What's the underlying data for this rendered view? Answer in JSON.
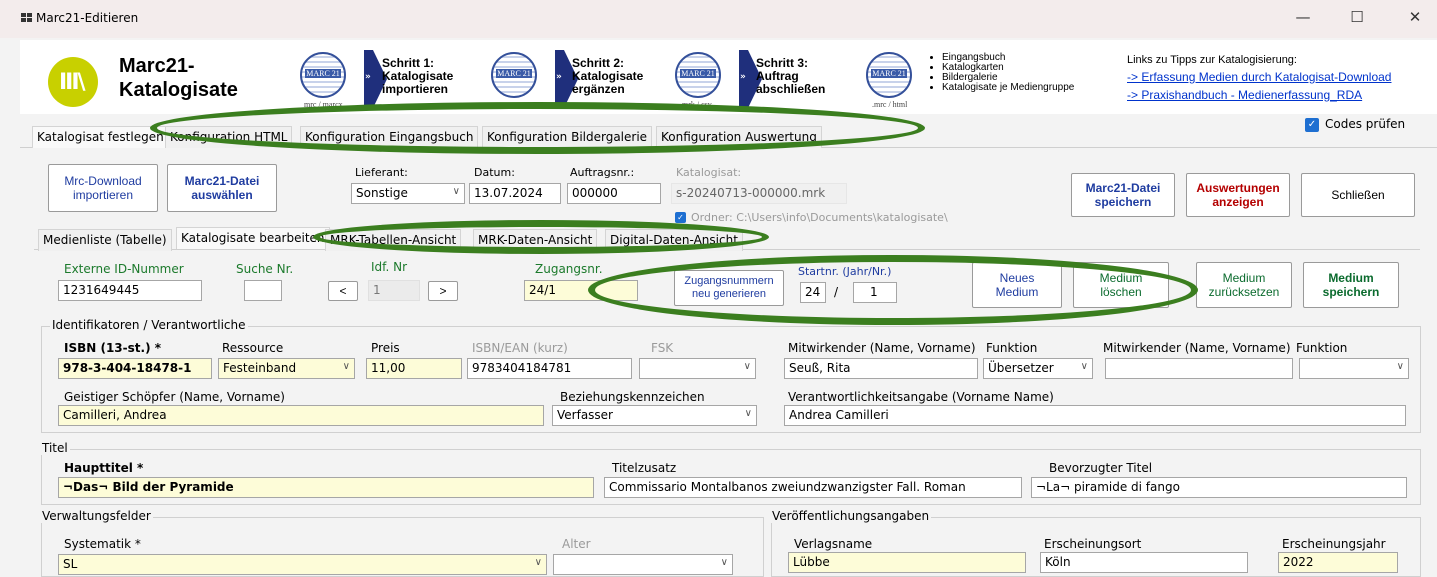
{
  "window": {
    "title": "Marc21-Editieren",
    "minimize": "—",
    "maximize": "☐",
    "close": "✕"
  },
  "banner": {
    "app_title_line1": "Marc21-",
    "app_title_line2": "Katalogisate",
    "logo_text": "III\\",
    "marc_label": "MARC 21",
    "captions": [
      "mrc / marcx",
      "mrk / csv",
      ".mrc / html"
    ],
    "steps": [
      {
        "line1": "Schritt 1:",
        "line2": "Katalogisate",
        "line3": "importieren"
      },
      {
        "line1": "Schritt 2:",
        "line2": "Katalogisate",
        "line3": "ergänzen"
      },
      {
        "line1": "Schritt 3:",
        "line2": "Auftrag",
        "line3": "abschließen"
      }
    ],
    "bullets": [
      "Eingangsbuch",
      "Katalogkarten",
      "Bildergalerie",
      "Katalogisate je Mediengruppe"
    ],
    "links_title": "Links zu Tipps zur Katalogisierung:",
    "link1": "-> Erfassung Medien durch Katalogisat-Download",
    "link2": "-> Praxishandbuch - Medienerfassung_RDA"
  },
  "main_tabs": [
    "Katalogisat festlegen",
    "Konfiguration HTML",
    "Konfiguration Eingangsbuch",
    "Konfiguration Bildergalerie",
    "Konfiguration Auswertung"
  ],
  "codes_pruefen": "Codes prüfen",
  "top": {
    "btn_mrc_download": [
      "Mrc-Download",
      "importieren"
    ],
    "btn_marc21_datei": [
      "Marc21-Datei",
      "auswählen"
    ],
    "lieferant_label": "Lieferant:",
    "lieferant_value": "Sonstige",
    "datum_label": "Datum:",
    "datum_value": "13.07.2024",
    "auftragsnr_label": "Auftragsnr.:",
    "auftragsnr_value": "000000",
    "katalogisat_label": "Katalogisat:",
    "katalogisat_value": "s-20240713-000000.mrk",
    "pfad_text": "Ordner: C:\\Users\\info\\Documents\\katalogisate\\",
    "btn_speichern": [
      "Marc21-Datei",
      "speichern"
    ],
    "btn_auswertungen": [
      "Auswertungen",
      "anzeigen"
    ],
    "btn_schliessen": "Schließen"
  },
  "sub_tabs": [
    "Medienliste (Tabelle)",
    "Katalogisate bearbeiten",
    "MRK-Tabellen-Ansicht",
    "MRK-Daten-Ansicht",
    "Digital-Daten-Ansicht"
  ],
  "nav": {
    "externe_id_label": "Externe ID-Nummer",
    "externe_id_value": "1231649445",
    "suche_label": "Suche Nr.",
    "idf_label": "Idf. Nr",
    "idf_value": "1",
    "prev": "<",
    "next": ">",
    "zugangsnr_label": "Zugangsnr.",
    "zugangsnr_value": "24/1",
    "btn_zugang_neu": [
      "Zugangsnummern",
      "neu generieren"
    ],
    "startnr_label": "Startnr. (Jahr/Nr.)",
    "startnr_jahr": "24",
    "startnr_slash": "/",
    "startnr_nr": "1",
    "btn_neues_medium": [
      "Neues",
      "Medium"
    ],
    "btn_medium_loeschen": [
      "Medium",
      "löschen"
    ],
    "btn_medium_zurueck": [
      "Medium",
      "zurücksetzen"
    ],
    "btn_medium_speichern": [
      "Medium",
      "speichern"
    ]
  },
  "ident": {
    "group": "Identifikatoren / Verantwortliche",
    "isbn_label": "ISBN (13-st.) *",
    "isbn_value": "978-3-404-18478-1",
    "ressource_label": "Ressource",
    "ressource_value": "Festeinband",
    "preis_label": "Preis",
    "preis_value": "11,00",
    "isbn_ean_label": "ISBN/EAN (kurz)",
    "isbn_ean_value": "9783404184781",
    "fsk_label": "FSK",
    "mitwirk1_label": "Mitwirkender (Name, Vorname)",
    "funktion1_label": "Funktion",
    "mitwirk1_value": "Seuß, Rita",
    "funktion1_value": "Übersetzer",
    "mitwirk2_label": "Mitwirkender (Name, Vorname)",
    "funktion2_label": "Funktion",
    "schoepfer_label": "Geistiger Schöpfer (Name, Vorname)",
    "schoepfer_value": "Camilleri, Andrea",
    "beziehung_label": "Beziehungskennzeichen",
    "beziehung_value": "Verfasser",
    "verantw_label": "Verantwortlichkeitsangabe (Vorname Name)",
    "verantw_value": "Andrea Camilleri"
  },
  "titel": {
    "group": "Titel",
    "haupttitel_label": "Haupttitel *",
    "haupttitel_value": "¬Das¬ Bild der Pyramide",
    "zusatz_label": "Titelzusatz",
    "zusatz_value": "Commissario Montalbanos zweiundzwanzigster Fall. Roman",
    "bevorzugt_label": "Bevorzugter Titel",
    "bevorzugt_value": "¬La¬ piramide di fango"
  },
  "verwaltung": {
    "group": "Verwaltungsfelder",
    "systematik_label": "Systematik *",
    "systematik_value": "SL",
    "alter_label": "Alter"
  },
  "veroeff": {
    "group": "Veröffentlichungsangaben",
    "verlag_label": "Verlagsname",
    "verlag_value": "Lübbe",
    "ort_label": "Erscheinungsort",
    "ort_value": "Köln",
    "jahr_label": "Erscheinungsjahr",
    "jahr_value": "2022"
  },
  "dropdown_arrow": "∨",
  "colors": {
    "annotation_ellipse": "#3b7e1f",
    "link": "#0033cc",
    "accent_blue": "#1f3ca0",
    "accent_green": "#0b6b2e",
    "accent_red": "#b40000",
    "required_yellow": "#fdfcd8"
  }
}
